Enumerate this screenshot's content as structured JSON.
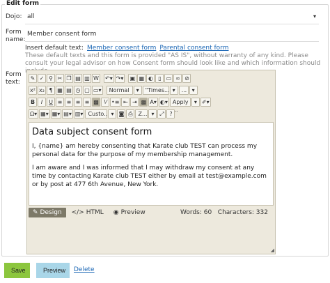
{
  "form": {
    "legend": "Edit form",
    "dojo_label": "Dojo:",
    "dojo_value": "all",
    "name_label": "Form name:",
    "name_value": "Member consent form",
    "defaults_label": "Insert default text:",
    "defaults_links": [
      "Member consent form",
      "Parental consent form"
    ],
    "disclaimer": "These default texts and this form is provided \"AS IS\", without warranty of any kind. Please consult your legal advisor on how Consent form should look like and which information should include.",
    "text_label": "Form text:"
  },
  "toolbar": {
    "format_value": "Normal",
    "font_value": "\"Times...",
    "size_value": "...",
    "apply_value": "Apply ...",
    "custom_value": "Custo...",
    "zoom_value": "Z..."
  },
  "editor": {
    "heading": "Data subject consent form",
    "paragraph1": "I, {name} am hereby consenting that Karate club TEST can process my personal data for the purpose of my membership management.",
    "paragraph2": "I am aware and I was informed that I may withdraw my consent at any time by contacting Karate club TEST either by email at test@example.com or by post at 477 6th Avenue, New York.",
    "modes": [
      "Design",
      "HTML",
      "Preview"
    ],
    "words": "Words: 60",
    "characters": "Characters: 332"
  },
  "actions": {
    "save": "Save",
    "preview": "Preview",
    "delete": "Delete"
  }
}
